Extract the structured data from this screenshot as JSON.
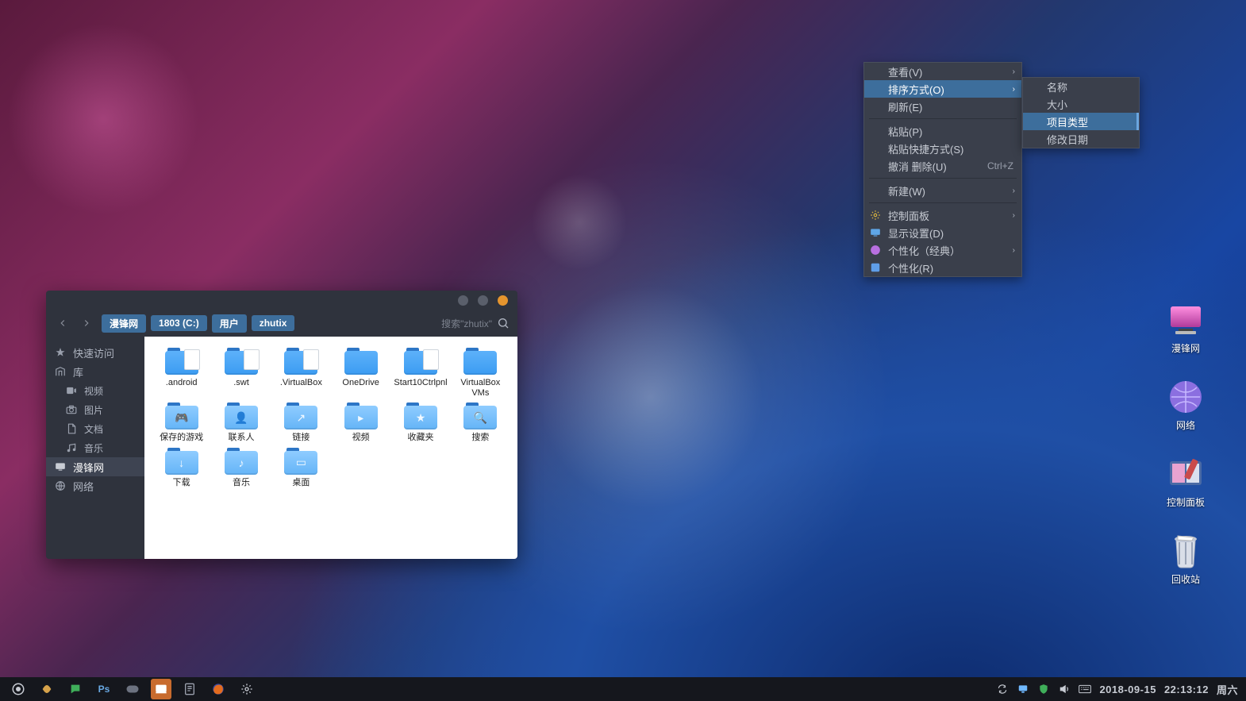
{
  "context_menu": {
    "items": [
      {
        "label": "查看(V)",
        "submenu": true
      },
      {
        "label": "排序方式(O)",
        "submenu": true,
        "highlighted": true
      },
      {
        "label": "刷新(E)"
      },
      {
        "sep": true
      },
      {
        "label": "粘贴(P)"
      },
      {
        "label": "粘贴快捷方式(S)"
      },
      {
        "label": "撤消 删除(U)",
        "shortcut": "Ctrl+Z"
      },
      {
        "sep": true
      },
      {
        "label": "新建(W)",
        "submenu": true
      },
      {
        "sep": true
      },
      {
        "label": "控制面板",
        "submenu": true,
        "icon": "gear"
      },
      {
        "label": "显示设置(D)",
        "icon": "monitor-small"
      },
      {
        "label": "个性化（经典）",
        "submenu": true,
        "icon": "palette"
      },
      {
        "label": "个性化(R)",
        "icon": "palette2"
      }
    ]
  },
  "sort_submenu": {
    "items": [
      {
        "label": "名称"
      },
      {
        "label": "大小"
      },
      {
        "label": "项目类型",
        "highlighted": true
      },
      {
        "label": "修改日期"
      }
    ]
  },
  "desktop_icons": [
    {
      "name": "computer",
      "label": "漫锋网",
      "icon": "monitor-pink"
    },
    {
      "name": "network",
      "label": "网络",
      "icon": "globe"
    },
    {
      "name": "control",
      "label": "控制面板",
      "icon": "panel"
    },
    {
      "name": "trash",
      "label": "回收站",
      "icon": "trash"
    }
  ],
  "file_manager": {
    "breadcrumbs": [
      "漫锋网",
      "1803 (C:)",
      "用户",
      "zhutix"
    ],
    "search_placeholder": "搜索\"zhutix\"",
    "sidebar": [
      {
        "label": "快速访问",
        "icon": "star"
      },
      {
        "label": "库",
        "icon": "library"
      },
      {
        "label": "视频",
        "icon": "video",
        "child": true
      },
      {
        "label": "图片",
        "icon": "camera",
        "child": true
      },
      {
        "label": "文档",
        "icon": "doc",
        "child": true
      },
      {
        "label": "音乐",
        "icon": "music",
        "child": true
      },
      {
        "label": "漫锋网",
        "icon": "monitor",
        "active": true
      },
      {
        "label": "网络",
        "icon": "globe-s"
      }
    ],
    "items": [
      {
        "label": ".android",
        "variant": "paper"
      },
      {
        "label": ".swt",
        "variant": "paper"
      },
      {
        "label": ".VirtualBox",
        "variant": "paper"
      },
      {
        "label": "OneDrive"
      },
      {
        "label": "Start10Ctrlpnl",
        "variant": "paper"
      },
      {
        "label": "VirtualBox VMs"
      },
      {
        "label": "保存的游戏",
        "glyph": "🎮",
        "variant": "light"
      },
      {
        "label": "联系人",
        "glyph": "👤",
        "variant": "light"
      },
      {
        "label": "链接",
        "glyph": "↗",
        "variant": "light"
      },
      {
        "label": "视频",
        "glyph": "▸",
        "variant": "light"
      },
      {
        "label": "收藏夹",
        "glyph": "★",
        "variant": "light"
      },
      {
        "label": "搜索",
        "glyph": "🔍",
        "variant": "light"
      },
      {
        "label": "下载",
        "glyph": "↓",
        "variant": "light"
      },
      {
        "label": "音乐",
        "glyph": "♪",
        "variant": "light"
      },
      {
        "label": "桌面",
        "glyph": "▭",
        "variant": "light"
      }
    ]
  },
  "taskbar": {
    "date": "2018-09-15",
    "time": "22:13:12",
    "weekday": "周六"
  }
}
